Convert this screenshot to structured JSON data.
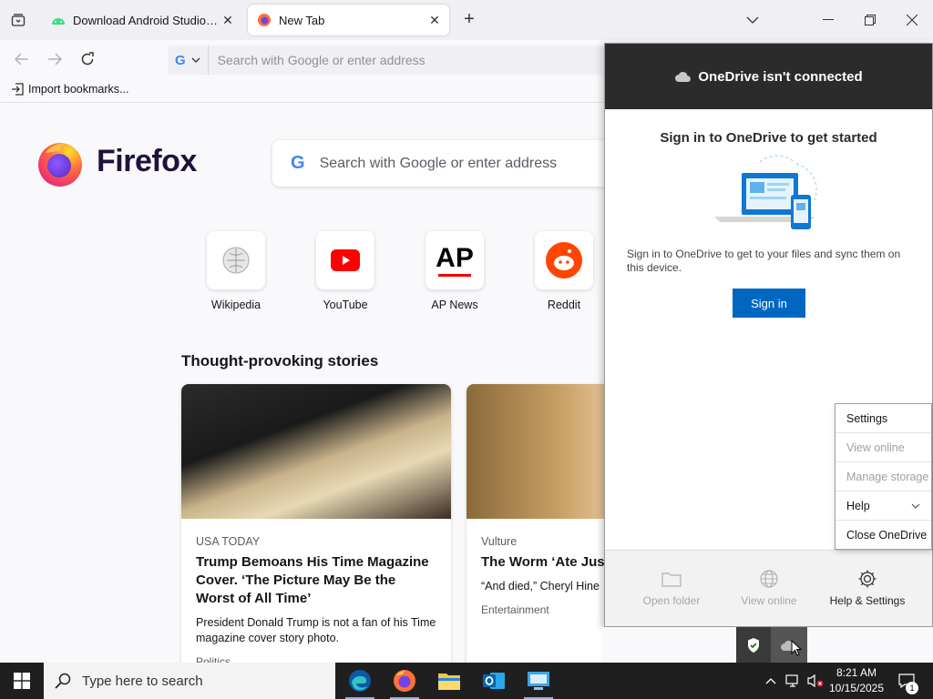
{
  "browser": {
    "tabs": [
      {
        "title": "Download Android Studio & Ap",
        "favicon": "android-icon"
      },
      {
        "title": "New Tab",
        "favicon": "firefox-icon"
      }
    ],
    "urlbar_placeholder": "Search with Google or enter address",
    "import_bookmarks": "Import bookmarks..."
  },
  "newtab": {
    "brand": "Firefox",
    "search_placeholder": "Search with Google or enter address",
    "shortcuts": [
      {
        "label": "Wikipedia",
        "icon": "wikipedia-icon"
      },
      {
        "label": "YouTube",
        "icon": "youtube-icon"
      },
      {
        "label": "AP News",
        "icon": "ap-news-icon",
        "logo_text": "AP"
      },
      {
        "label": "Reddit",
        "icon": "reddit-icon"
      }
    ],
    "stories_heading": "Thought-provoking stories",
    "stories": [
      {
        "source": "USA TODAY",
        "headline": "Trump Bemoans His Time Magazine Cover. ‘The Picture May Be the Worst of All Time’",
        "excerpt": "President Donald Trump is not a fan of his Time magazine cover story photo.",
        "context": "Politics"
      },
      {
        "source": "Vulture",
        "headline": "The Worm ‘Ate Just Jr.’s Brain",
        "excerpt": "“And died,” Cheryl Hine",
        "context": "Entertainment"
      }
    ]
  },
  "onedrive": {
    "header": "OneDrive isn't connected",
    "title": "Sign in to OneDrive to get started",
    "description": "Sign in to OneDrive to get to your files and sync them on this device.",
    "signin_label": "Sign in",
    "footer": [
      {
        "label": "Open folder",
        "icon": "folder-icon",
        "enabled": false
      },
      {
        "label": "View online",
        "icon": "globe-icon",
        "enabled": false
      },
      {
        "label": "Help & Settings",
        "icon": "gear-icon",
        "enabled": true
      }
    ],
    "menu": [
      {
        "label": "Settings",
        "enabled": true
      },
      {
        "label": "View online",
        "enabled": false
      },
      {
        "label": "Manage storage",
        "enabled": false
      },
      {
        "label": "Help",
        "enabled": true,
        "submenu": true
      },
      {
        "label": "Close OneDrive",
        "enabled": true
      }
    ]
  },
  "taskbar": {
    "search_placeholder": "Type here to search",
    "apps": [
      "edge-icon",
      "firefox-icon",
      "file-explorer-icon",
      "outlook-icon",
      "remote-desktop-icon"
    ],
    "time": "8:21 AM",
    "date": "10/15/2025",
    "notification_count": "1"
  },
  "colors": {
    "accent_blue": "#0067c0",
    "onedrive_header": "#2b2b2b",
    "taskbar": "#1f1f1f"
  }
}
